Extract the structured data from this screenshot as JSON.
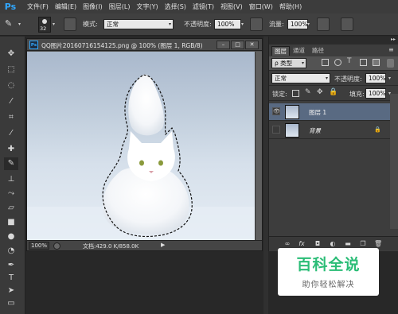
{
  "app": {
    "logo": "Ps"
  },
  "menu": [
    "文件(F)",
    "编辑(E)",
    "图像(I)",
    "图层(L)",
    "文字(Y)",
    "选择(S)",
    "滤镜(T)",
    "视图(V)",
    "窗口(W)",
    "帮助(H)"
  ],
  "options_bar": {
    "brush_size": "32",
    "mode_label": "模式:",
    "mode_value": "正常",
    "opacity_label": "不透明度:",
    "opacity_value": "100%",
    "flow_label": "流量:",
    "flow_value": "100%"
  },
  "document": {
    "title": "QQ图片20160716154125.png @ 100% (图层 1, RGB/8)",
    "zoom": "100%",
    "info": "文档:429.0 K/858.0K"
  },
  "layers_panel": {
    "tabs": [
      "图层",
      "通道",
      "路径"
    ],
    "kind_label": "ρ 类型",
    "blend_mode": "正常",
    "opacity_label": "不透明度:",
    "opacity_value": "100%",
    "lock_label": "锁定:",
    "fill_label": "填充:",
    "fill_value": "100%",
    "layers": [
      {
        "name": "图层 1",
        "visible": true,
        "selected": true
      },
      {
        "name": "背景",
        "visible": false,
        "selected": false,
        "locked": true
      }
    ]
  },
  "watermark": {
    "title": "百科全说",
    "subtitle": "助你轻松解决"
  },
  "colors": {
    "accent": "#31a8ff",
    "watermark_green": "#2bbd77",
    "selected_layer": "#596a82"
  }
}
